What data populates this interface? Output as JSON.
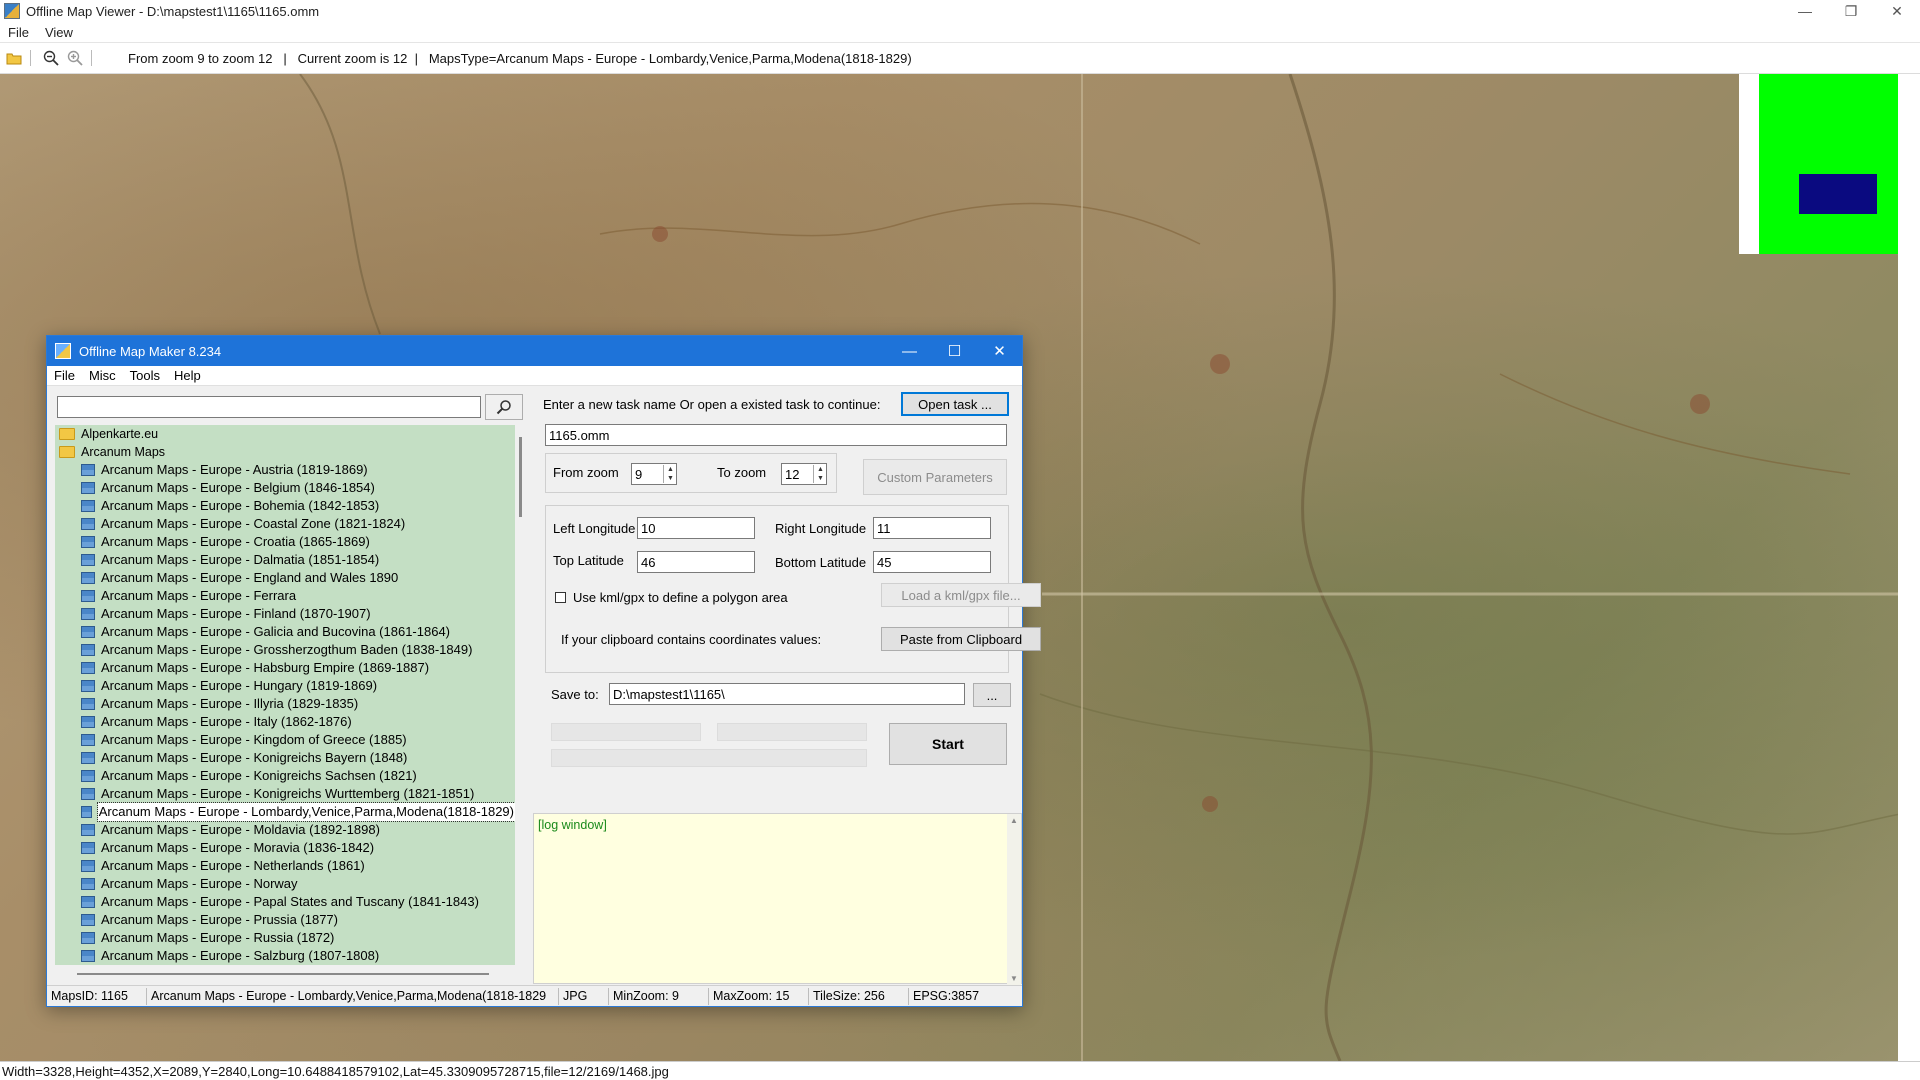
{
  "viewer": {
    "title": "Offline Map Viewer - D:\\mapstest1\\1165\\1165.omm",
    "menu": [
      "File",
      "View"
    ],
    "toolbar": {
      "zoom_range": "From zoom 9 to zoom 12",
      "current_zoom": "Current zoom is 12",
      "maps_type": "MapsType=Arcanum Maps - Europe - Lombardy,Venice,Parma,Modena(1818-1829)"
    },
    "status": "Width=3328,Height=4352,X=2089,Y=2840,Long=10.6488418579102,Lat=45.3309095728715,file=12/2169/1468.jpg",
    "minimap_colors": {
      "background": "#00ff00",
      "viewport": "#0a0a80"
    }
  },
  "dialog": {
    "title": "Offline Map Maker 8.234",
    "menu": [
      "File",
      "Misc",
      "Tools",
      "Help"
    ],
    "search": {
      "value": ""
    },
    "tree": {
      "folders": [
        {
          "label": "Alpenkarte.eu",
          "expanded": false
        },
        {
          "label": "Arcanum Maps",
          "expanded": true
        }
      ],
      "items": [
        "Arcanum Maps - Europe - Austria (1819-1869)",
        "Arcanum Maps - Europe - Belgium (1846-1854)",
        "Arcanum Maps - Europe - Bohemia (1842-1853)",
        "Arcanum Maps - Europe - Coastal Zone (1821-1824)",
        "Arcanum Maps - Europe - Croatia (1865-1869)",
        "Arcanum Maps - Europe - Dalmatia (1851-1854)",
        "Arcanum Maps - Europe - England and Wales 1890",
        "Arcanum Maps - Europe - Ferrara",
        "Arcanum Maps - Europe - Finland (1870-1907)",
        "Arcanum Maps - Europe - Galicia and Bucovina (1861-1864)",
        "Arcanum Maps - Europe - Grossherzogthum Baden (1838-1849)",
        "Arcanum Maps - Europe - Habsburg Empire (1869-1887)",
        "Arcanum Maps - Europe - Hungary (1819-1869)",
        "Arcanum Maps - Europe - Illyria (1829-1835)",
        "Arcanum Maps - Europe - Italy (1862-1876)",
        "Arcanum Maps - Europe - Kingdom of Greece (1885)",
        "Arcanum Maps - Europe - Konigreichs Bayern (1848)",
        "Arcanum Maps - Europe - Konigreichs Sachsen (1821)",
        "Arcanum Maps - Europe - Konigreichs Wurttemberg (1821-1851)",
        "Arcanum Maps - Europe - Lombardy,Venice,Parma,Modena(1818-1829)",
        "Arcanum Maps - Europe - Moldavia (1892-1898)",
        "Arcanum Maps - Europe - Moravia (1836-1842)",
        "Arcanum Maps - Europe - Netherlands (1861)",
        "Arcanum Maps - Europe - Norway",
        "Arcanum Maps - Europe - Papal States and Tuscany (1841-1843)",
        "Arcanum Maps - Europe - Prussia (1877)",
        "Arcanum Maps - Europe - Russia (1872)",
        "Arcanum Maps - Europe - Salzburg (1807-1808)"
      ],
      "selected_index": 19
    },
    "form": {
      "task_prompt": "Enter a new task name Or open a existed task to continue:",
      "open_task_label": "Open task ...",
      "task_name": "1165.omm",
      "from_zoom_label": "From zoom",
      "from_zoom": "9",
      "to_zoom_label": "To zoom",
      "to_zoom": "12",
      "custom_params_label": "Custom Parameters",
      "left_long_label": "Left Longitude",
      "left_long": "10",
      "right_long_label": "Right Longitude",
      "right_long": "11",
      "top_lat_label": "Top Latitude",
      "top_lat": "46",
      "bottom_lat_label": "Bottom Latitude",
      "bottom_lat": "45",
      "kml_label": "Use kml/gpx to define a polygon area",
      "load_kml_label": "Load a kml/gpx file...",
      "clipboard_prompt": "If your clipboard contains coordinates values:",
      "paste_label": "Paste from Clipboard",
      "save_to_label": "Save to:",
      "save_to": "D:\\mapstest1\\1165\\",
      "browse_label": "...",
      "start_label": "Start"
    },
    "log": "[log window]",
    "status": {
      "maps_id": "MapsID: 1165",
      "maps_name": "Arcanum Maps - Europe - Lombardy,Venice,Parma,Modena(1818-1829",
      "format": "JPG",
      "min_zoom": "MinZoom: 9",
      "max_zoom": "MaxZoom: 15",
      "tile_size": "TileSize: 256",
      "epsg": "EPSG:3857"
    }
  }
}
